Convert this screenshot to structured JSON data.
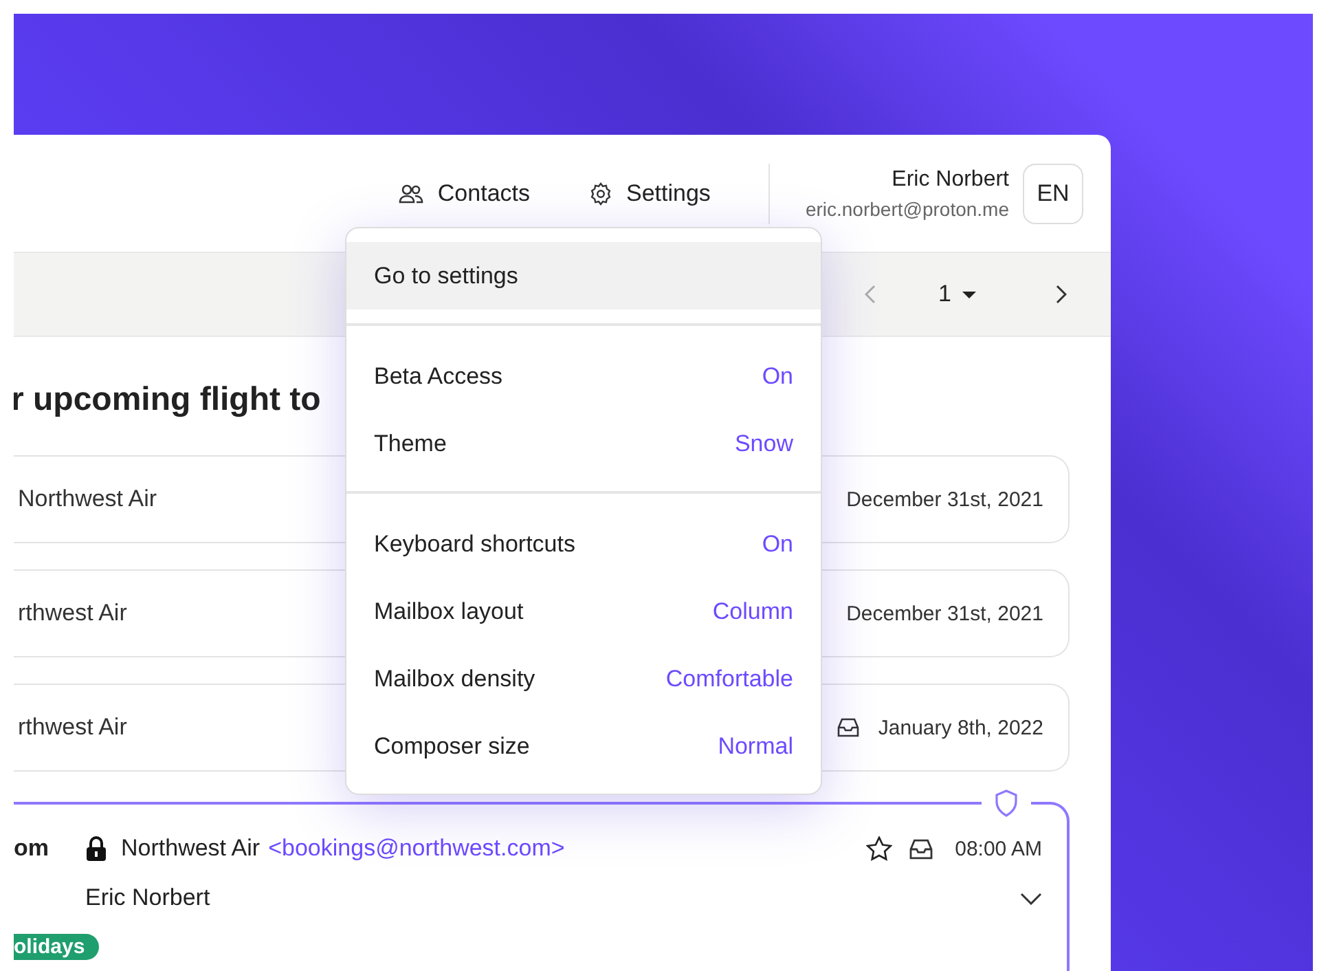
{
  "header": {
    "nav": [
      {
        "kind": "contacts",
        "label": "Contacts"
      },
      {
        "kind": "settings",
        "label": "Settings"
      }
    ],
    "user": {
      "name": "Eric Norbert",
      "email": "eric.norbert@proton.me",
      "initials": "EN"
    }
  },
  "toolbar": {
    "page": "1"
  },
  "subject": "r upcoming flight to",
  "messages": [
    {
      "kind": "plain",
      "sender": "Northwest Air",
      "date": "December 31st, 2021"
    },
    {
      "kind": "plain",
      "sender": "rthwest Air",
      "date": "December 31st, 2021"
    },
    {
      "kind": "inbox",
      "sender": "rthwest Air",
      "date": "January 8th, 2022"
    }
  ],
  "open_message": {
    "label": "om",
    "sender": "Northwest Air",
    "address": "<bookings@northwest.com>",
    "time": "08:00 AM",
    "recipient": "Eric Norbert",
    "tag": {
      "label": "olidays",
      "color": "#1f9e6e"
    }
  },
  "settings_menu": {
    "sections": [
      [
        {
          "label": "Go to settings",
          "selected": true
        }
      ],
      [
        {
          "label": "Beta Access",
          "value": "On",
          "selected": false
        },
        {
          "label": "Theme",
          "value": "Snow",
          "selected": false
        }
      ],
      [
        {
          "label": "Keyboard shortcuts",
          "value": "On",
          "selected": false
        },
        {
          "label": "Mailbox layout",
          "value": "Column",
          "selected": false
        },
        {
          "label": "Mailbox density",
          "value": "Comfortable",
          "selected": false
        },
        {
          "label": "Composer size",
          "value": "Normal",
          "selected": false
        }
      ]
    ]
  }
}
